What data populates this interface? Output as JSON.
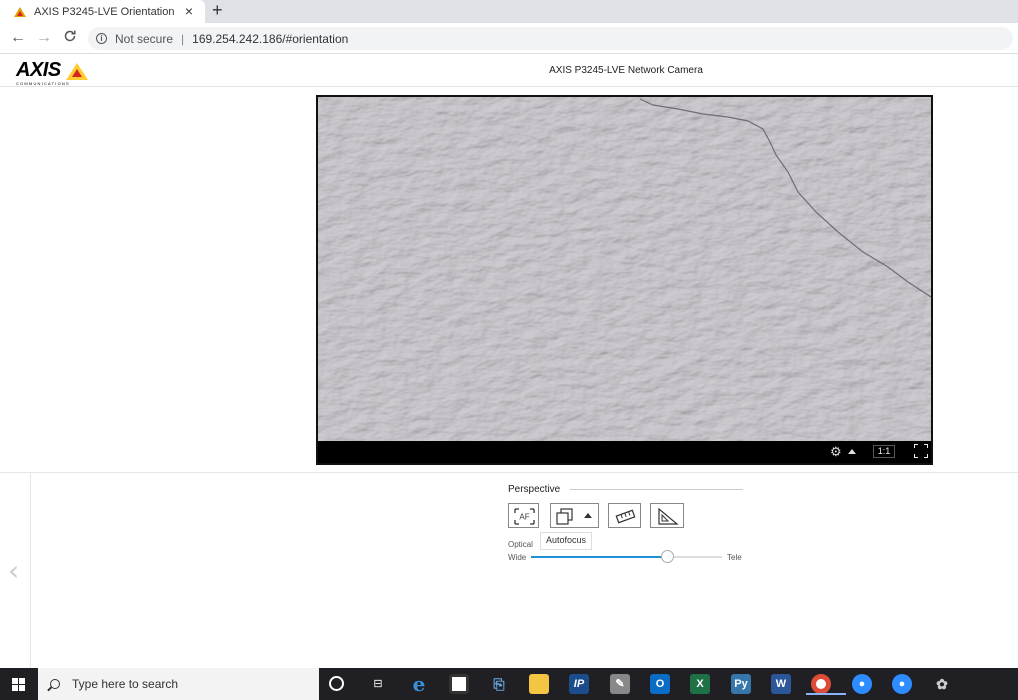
{
  "browser": {
    "tab_title": "AXIS P3245-LVE Orientation",
    "tab_close": "×",
    "new_tab": "+",
    "back": "←",
    "forward": "→",
    "reload": "C",
    "not_secure": "Not secure",
    "separator": "|",
    "url": "169.254.242.186/#orientation"
  },
  "header": {
    "logo_text": "AXIS",
    "logo_sub": "COMMUNICATIONS",
    "camera_title": "AXIS P3245-LVE Network Camera"
  },
  "video": {
    "ratio_label": "1:1"
  },
  "controls": {
    "perspective_label": "Perspective",
    "tooltip": "Autofocus",
    "optical_label": "Optical",
    "wide_label": "Wide",
    "tele_label": "Tele",
    "zoom_fraction": 0.71,
    "accent": "#1f8fd4",
    "af_text": "AF"
  },
  "taskbar": {
    "search_placeholder": "Type here to search",
    "icons": [
      "cortana-icon",
      "task-view-icon",
      "edge-icon",
      "terminal-icon",
      "network-icon",
      "file-explorer-icon",
      "ip-icon",
      "tool-icon",
      "outlook-icon",
      "excel-icon",
      "python-icon",
      "word-icon",
      "chrome-icon",
      "zoom-icon",
      "zoom-icon-2",
      "gimp-icon"
    ]
  }
}
